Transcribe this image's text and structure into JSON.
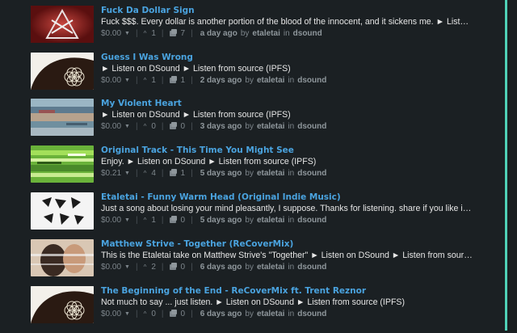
{
  "posts": [
    {
      "title": "Fuck Da Dollar Sign",
      "body": "Fuck $$$. Every dollar is another portion of the blood of the innocent, and it sickens me. ► Listen on DSound ► Listen from source (IPFS)",
      "payout": "$0.00",
      "votes": "1",
      "comments": "7",
      "time": "a day ago",
      "by_label": "by",
      "author": "etaletai",
      "in_label": "in",
      "category": "dsound",
      "thumb": "thumb-red-triangle"
    },
    {
      "title": "Guess I Was Wrong",
      "body": "► Listen on DSound ► Listen from source (IPFS)",
      "payout": "$0.00",
      "votes": "1",
      "comments": "1",
      "time": "2 days ago",
      "by_label": "by",
      "author": "etaletai",
      "in_label": "in",
      "category": "dsound",
      "thumb": "thumb-flower-of-life"
    },
    {
      "title": "My Violent Heart",
      "body": "► Listen on DSound ► Listen from source (IPFS)",
      "payout": "$0.00",
      "votes": "0",
      "comments": "0",
      "time": "3 days ago",
      "by_label": "by",
      "author": "etaletai",
      "in_label": "in",
      "category": "dsound",
      "thumb": "thumb-glitch-blue"
    },
    {
      "title": "Original Track - This Time You Might See",
      "body": "Enjoy. ► Listen on DSound ► Listen from source (IPFS)",
      "payout": "$0.21",
      "votes": "4",
      "comments": "1",
      "time": "5 days ago",
      "by_label": "by",
      "author": "etaletai",
      "in_label": "in",
      "category": "dsound",
      "thumb": "thumb-glitch-green"
    },
    {
      "title": "Etaletai - Funny Warm Head (Original Indie Music)",
      "body": "Just a song about losing your mind pleasantly, I suppose. Thanks for listening. share if you like it, follow if you want more",
      "payout": "$0.00",
      "votes": "1",
      "comments": "0",
      "time": "5 days ago",
      "by_label": "by",
      "author": "etaletai",
      "in_label": "in",
      "category": "dsound",
      "thumb": "thumb-logo-white"
    },
    {
      "title": "Matthew Strive - Together (ReCoverMix)",
      "body": "This is the Etaletai take on Matthew Strive's \"Together\" ► Listen on DSound ► Listen from source (IPFS)",
      "payout": "$0.00",
      "votes": "2",
      "comments": "0",
      "time": "6 days ago",
      "by_label": "by",
      "author": "etaletai",
      "in_label": "in",
      "category": "dsound",
      "thumb": "thumb-couple"
    },
    {
      "title": "The Beginning of the End - ReCoverMix ft. Trent Reznor",
      "body": "Not much to say ... just listen. ► Listen on DSound ► Listen from source (IPFS)",
      "payout": "$0.00",
      "votes": "0",
      "comments": "0",
      "time": "6 days ago",
      "by_label": "by",
      "author": "etaletai",
      "in_label": "in",
      "category": "dsound",
      "thumb": "thumb-flower-of-life"
    }
  ],
  "icons": {
    "vote": "upvote-icon",
    "comments": "comment-icon",
    "payout_dropdown": "chevron-down-icon"
  },
  "colors": {
    "background": "#1b2023",
    "title": "#4aa3df",
    "body": "#e6e6e6",
    "meta": "#7d858b",
    "accent_line": "#4fd1b7"
  }
}
